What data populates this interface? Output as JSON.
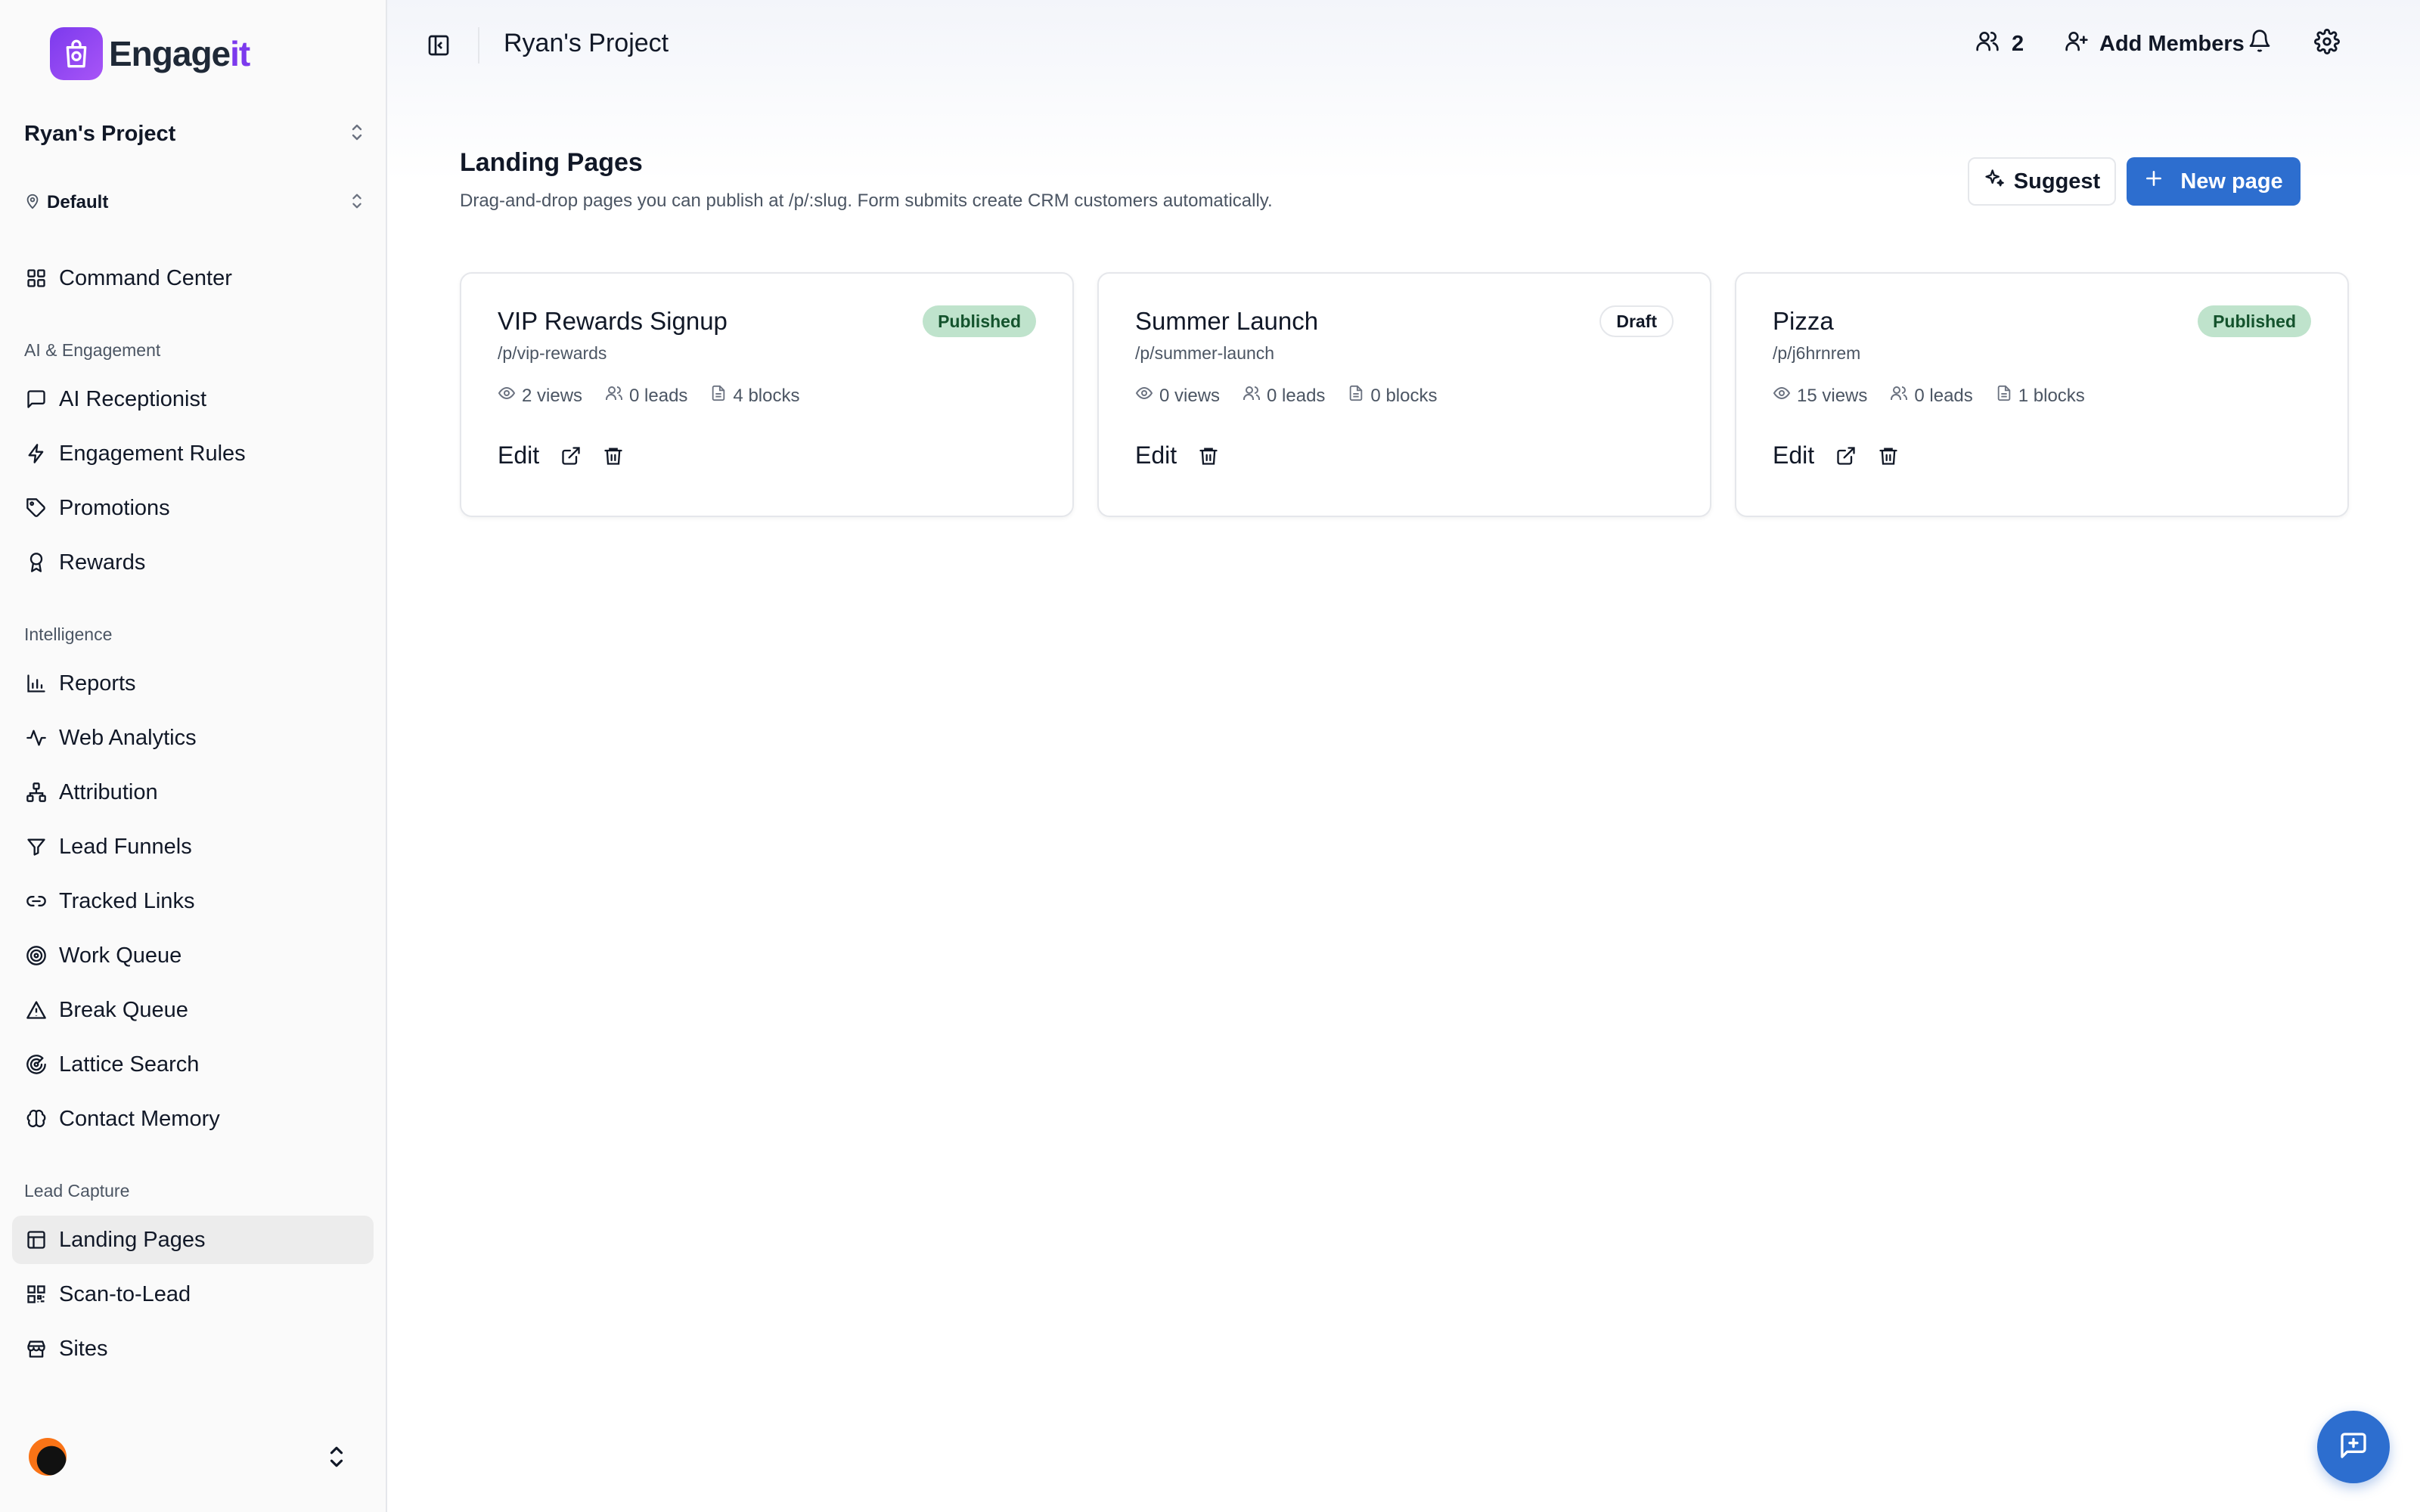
{
  "brand": {
    "name_main": "Engage",
    "name_accent": "it",
    "logo_icon": "shopping-bag-icon"
  },
  "sidebar": {
    "project": "Ryan's Project",
    "location": "Default",
    "command_center": "Command Center",
    "sections": {
      "ai": "AI & Engagement",
      "intelligence": "Intelligence",
      "lead_capture": "Lead Capture"
    },
    "ai_items": [
      {
        "label": "AI Receptionist",
        "icon": "message-square-icon"
      },
      {
        "label": "Engagement Rules",
        "icon": "zap-icon"
      },
      {
        "label": "Promotions",
        "icon": "tag-icon"
      },
      {
        "label": "Rewards",
        "icon": "award-icon"
      }
    ],
    "intelligence_items": [
      {
        "label": "Reports",
        "icon": "bar-chart-icon"
      },
      {
        "label": "Web Analytics",
        "icon": "activity-icon"
      },
      {
        "label": "Attribution",
        "icon": "network-icon"
      },
      {
        "label": "Lead Funnels",
        "icon": "filter-icon"
      },
      {
        "label": "Tracked Links",
        "icon": "link-icon"
      },
      {
        "label": "Work Queue",
        "icon": "target-icon"
      },
      {
        "label": "Break Queue",
        "icon": "alert-triangle-icon"
      },
      {
        "label": "Lattice Search",
        "icon": "radar-icon"
      },
      {
        "label": "Contact Memory",
        "icon": "brain-icon"
      }
    ],
    "lead_capture_items": [
      {
        "label": "Landing Pages",
        "icon": "layout-icon",
        "active": true
      },
      {
        "label": "Scan-to-Lead",
        "icon": "qr-code-icon"
      },
      {
        "label": "Sites",
        "icon": "store-icon"
      }
    ]
  },
  "topbar": {
    "title": "Ryan's Project",
    "members_count": "2",
    "add_members": "Add Members"
  },
  "page": {
    "title": "Landing Pages",
    "subtitle": "Drag-and-drop pages you can publish at /p/:slug. Form submits create CRM customers automatically.",
    "suggest_label": "Suggest",
    "new_page_label": "New page"
  },
  "cards": [
    {
      "title": "VIP Rewards Signup",
      "slug": "/p/vip-rewards",
      "status": "Published",
      "views": "2 views",
      "leads": "0 leads",
      "blocks": "4 blocks",
      "edit": "Edit"
    },
    {
      "title": "Summer Launch",
      "slug": "/p/summer-launch",
      "status": "Draft",
      "views": "0 views",
      "leads": "0 leads",
      "blocks": "0 blocks",
      "edit": "Edit"
    },
    {
      "title": "Pizza",
      "slug": "/p/j6hrnrem",
      "status": "Published",
      "views": "15 views",
      "leads": "0 leads",
      "blocks": "1 blocks",
      "edit": "Edit"
    }
  ],
  "colors": {
    "accent": "#2d6ecf",
    "brand": "#7c3aed",
    "published_bg": "#bfe3cc"
  }
}
